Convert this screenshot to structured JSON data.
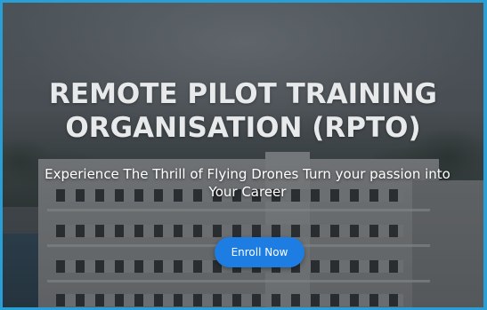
{
  "hero": {
    "headline_line1": "REMOTE PILOT TRAINING",
    "headline_line2": "ORGANISATION (RPTO)",
    "subtitle_line1": "Experience The Thrill of Flying Drones Turn your passion into",
    "subtitle_line2": "Your Career",
    "cta_label": "Enroll Now"
  },
  "colors": {
    "frame_border": "#2a9fd6",
    "cta_background": "#1e7de2",
    "headline_text": "#e7e9ea",
    "subtitle_text": "#ffffff"
  }
}
